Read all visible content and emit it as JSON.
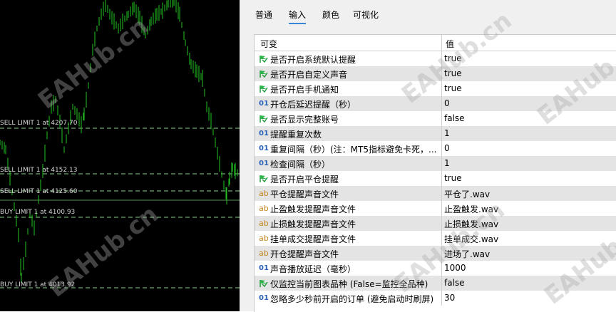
{
  "chart": {
    "candle_color": "#22c322",
    "level_line_color": "#8ad38a",
    "levels": [
      {
        "label": "SELL LIMIT 1 at 4207.70"
      },
      {
        "label": "SELL LIMIT 1 at 4152.13"
      },
      {
        "label": "SELL LIMIT 1 at 4125.60"
      },
      {
        "label": "BUY LIMIT 1 at 4100.93"
      },
      {
        "label": "BUY LIMIT 1 at 4013.92"
      }
    ]
  },
  "tabs": [
    {
      "label": "普通",
      "active": false
    },
    {
      "label": "输入",
      "active": true
    },
    {
      "label": "颜色",
      "active": false
    },
    {
      "label": "可视化",
      "active": false
    }
  ],
  "table": {
    "header_variable": "可变",
    "header_value": "值",
    "rows": [
      {
        "icon": "flag",
        "name": "是否开启系统默认提醒",
        "value": "true"
      },
      {
        "icon": "flag",
        "name": "是否开启自定义声音",
        "value": "true"
      },
      {
        "icon": "flag",
        "name": "是否开启手机通知",
        "value": "true"
      },
      {
        "icon": "num",
        "name": "开仓后延迟提醒（秒）",
        "value": "0"
      },
      {
        "icon": "flag",
        "name": "是否显示完整账号",
        "value": "false"
      },
      {
        "icon": "num",
        "name": "提醒重复次数",
        "value": "1"
      },
      {
        "icon": "num",
        "name": "重复间隔（秒）(注：MT5指标避免卡死，...",
        "value": "0"
      },
      {
        "icon": "num",
        "name": "检查间隔（秒）",
        "value": "1"
      },
      {
        "icon": "flag",
        "name": "是否开启平仓提醒",
        "value": "true"
      },
      {
        "icon": "ab",
        "name": "平仓提醒声音文件",
        "value": "平仓了.wav"
      },
      {
        "icon": "ab",
        "name": "止盈触发提醒声音文件",
        "value": "止盈触发.wav"
      },
      {
        "icon": "ab",
        "name": "止损触发提醒声音文件",
        "value": "止损触发.wav"
      },
      {
        "icon": "ab",
        "name": "挂单成交提醒声音文件",
        "value": "挂单成交.wav"
      },
      {
        "icon": "ab",
        "name": "开仓提醒声音文件",
        "value": "进场了.wav"
      },
      {
        "icon": "num",
        "name": "声音播放延迟（毫秒）",
        "value": "1000"
      },
      {
        "icon": "flag",
        "name": "仅监控当前图表品种 (False=监控全品种)",
        "value": "false"
      },
      {
        "icon": "num",
        "name": "忽略多少秒前开启的订单 (避免启动时刷屏)",
        "value": "30"
      }
    ],
    "icon_num_text": "01",
    "icon_ab_text": "ab"
  },
  "watermark": "EAHub.cn"
}
